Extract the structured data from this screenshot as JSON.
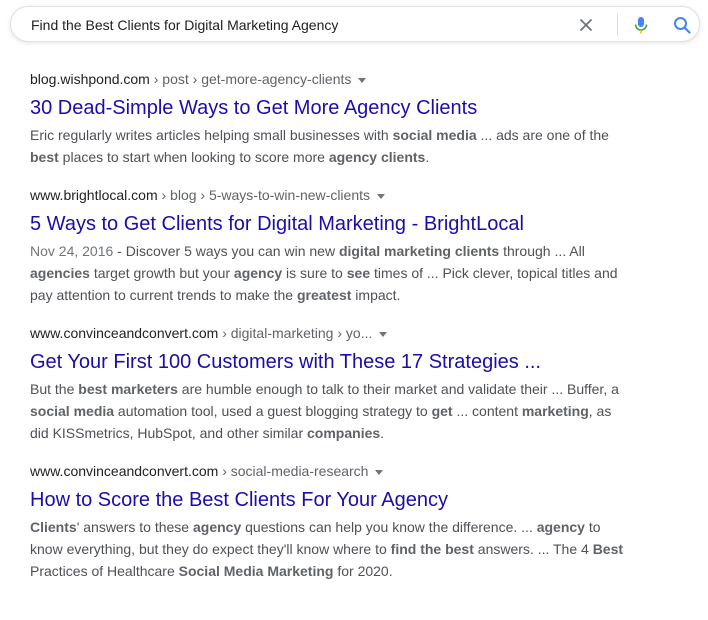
{
  "search": {
    "query": "Find the Best Clients for Digital Marketing Agency",
    "clear_icon": "close-icon",
    "mic_icon": "microphone-icon",
    "search_icon": "magnifier-icon"
  },
  "colors": {
    "title_link": "#1a0dab",
    "snippet_text": "#4d5156",
    "bold_text": "#5f6368",
    "mic_accent": "#4285f4"
  },
  "results": [
    {
      "domain": "blog.wishpond.com",
      "path": " › post › get-more-agency-clients",
      "title": "30 Dead-Simple Ways to Get More Agency Clients",
      "snippet": [
        {
          "t": "Eric regularly writes articles helping small businesses with "
        },
        {
          "t": "social media",
          "b": true
        },
        {
          "t": " ... ads are one of the "
        },
        {
          "br": true
        },
        {
          "t": "best",
          "b": true
        },
        {
          "t": " places to start when looking to score more "
        },
        {
          "t": "agency clients",
          "b": true
        },
        {
          "t": "."
        }
      ]
    },
    {
      "domain": "www.brightlocal.com",
      "path": " › blog › 5-ways-to-win-new-clients",
      "title": "5 Ways to Get Clients for Digital Marketing - BrightLocal",
      "snippet": [
        {
          "t": "Nov 24, 2016",
          "d": true
        },
        {
          "t": " - Discover 5 ways you can win new "
        },
        {
          "t": "digital marketing clients",
          "b": true
        },
        {
          "t": " through ... All "
        },
        {
          "br": true
        },
        {
          "t": "agencies",
          "b": true
        },
        {
          "t": " target growth but your "
        },
        {
          "t": "agency",
          "b": true
        },
        {
          "t": " is sure to "
        },
        {
          "t": "see",
          "b": true
        },
        {
          "t": " times of ... Pick clever, topical titles and "
        },
        {
          "br": true
        },
        {
          "t": "pay attention to current trends to make the "
        },
        {
          "t": "greatest",
          "b": true
        },
        {
          "t": " impact."
        }
      ]
    },
    {
      "domain": "www.convinceandconvert.com",
      "path": " › digital-marketing › yo...",
      "title": "Get Your First 100 Customers with These 17 Strategies ...",
      "snippet": [
        {
          "t": "But the "
        },
        {
          "t": "best marketers",
          "b": true
        },
        {
          "t": " are humble enough to talk to their market and validate their ... Buffer, a "
        },
        {
          "br": true
        },
        {
          "t": "social media",
          "b": true
        },
        {
          "t": " automation tool, used a guest blogging strategy to "
        },
        {
          "t": "get",
          "b": true
        },
        {
          "t": " ... content "
        },
        {
          "t": "marketing",
          "b": true
        },
        {
          "t": ", as "
        },
        {
          "br": true
        },
        {
          "t": "did KISSmetrics, HubSpot, and other similar "
        },
        {
          "t": "companies",
          "b": true
        },
        {
          "t": "."
        }
      ]
    },
    {
      "domain": "www.convinceandconvert.com",
      "path": " › social-media-research",
      "title": "How to Score the Best Clients For Your Agency",
      "snippet": [
        {
          "t": "Clients",
          "b": true
        },
        {
          "t": "' answers to these "
        },
        {
          "t": "agency",
          "b": true
        },
        {
          "t": " questions can help you know the difference. ... "
        },
        {
          "t": "agency",
          "b": true
        },
        {
          "t": " to "
        },
        {
          "br": true
        },
        {
          "t": "know everything, but they do expect they'll know where to "
        },
        {
          "t": "find the best",
          "b": true
        },
        {
          "t": " answers. ... The 4 "
        },
        {
          "t": "Best",
          "b": true
        },
        {
          "br": true
        },
        {
          "t": "Practices of Healthcare "
        },
        {
          "t": "Social Media Marketing",
          "b": true
        },
        {
          "t": " for 2020."
        }
      ]
    }
  ]
}
